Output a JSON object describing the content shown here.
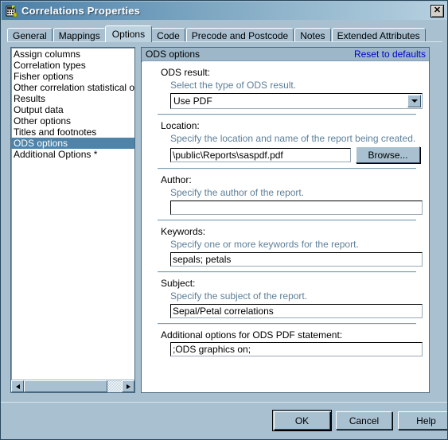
{
  "window": {
    "title": "Correlations Properties",
    "icon": "properties-table-icon",
    "close_label": "✕"
  },
  "tabs": [
    {
      "label": "General",
      "active": false
    },
    {
      "label": "Mappings",
      "active": false
    },
    {
      "label": "Options",
      "active": true
    },
    {
      "label": "Code",
      "active": false
    },
    {
      "label": "Precode and Postcode",
      "active": false
    },
    {
      "label": "Notes",
      "active": false
    },
    {
      "label": "Extended Attributes",
      "active": false
    }
  ],
  "category_list": {
    "items": [
      {
        "label": "Assign columns",
        "selected": false
      },
      {
        "label": "Correlation types",
        "selected": false
      },
      {
        "label": "Fisher options",
        "selected": false
      },
      {
        "label": "Other correlation statistical op",
        "selected": false
      },
      {
        "label": "Results",
        "selected": false
      },
      {
        "label": "Output data",
        "selected": false
      },
      {
        "label": "Other options",
        "selected": false
      },
      {
        "label": "Titles and footnotes",
        "selected": false
      },
      {
        "label": "ODS options",
        "selected": true
      },
      {
        "label": "Additional Options *",
        "selected": false
      }
    ],
    "scrollbar": {
      "thumb_percent": 85
    }
  },
  "options_panel": {
    "header_title": "ODS options",
    "reset_label": "Reset to defaults",
    "fields": {
      "ods_result": {
        "label": "ODS result:",
        "description": "Select the type of ODS result.",
        "value": "Use PDF"
      },
      "location": {
        "label": "Location:",
        "description": "Specify the location and name of the report being created.",
        "value": "\\public\\Reports\\saspdf.pdf",
        "browse_label": "Browse..."
      },
      "author": {
        "label": "Author:",
        "description": "Specify the author of the report.",
        "value": ""
      },
      "keywords": {
        "label": "Keywords:",
        "description": "Specify one or more keywords for the report.",
        "value": "sepals; petals"
      },
      "subject": {
        "label": "Subject:",
        "description": "Specify the subject of the report.",
        "value": "Sepal/Petal correlations"
      },
      "additional": {
        "label": "Additional options for ODS PDF statement:",
        "value": ";ODS graphics on;"
      }
    }
  },
  "buttons": {
    "ok": "OK",
    "cancel": "Cancel",
    "help": "Help"
  },
  "colors": {
    "dialog_bg": "#a8c0d0",
    "title_start": "#4c7fa6",
    "title_end": "#b6d0e0",
    "selection": "#4f83a8",
    "link": "#0000cc",
    "description_text": "#5c7f99"
  }
}
